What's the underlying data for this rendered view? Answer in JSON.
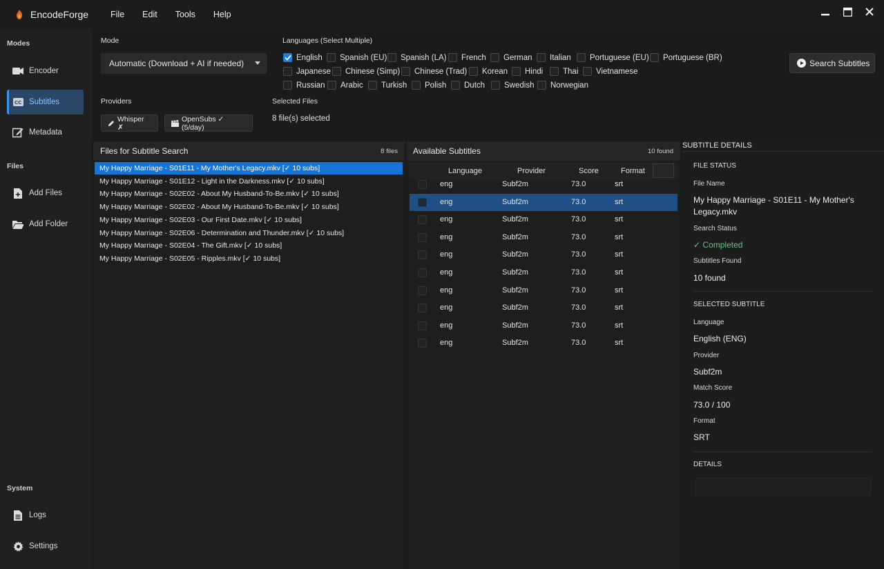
{
  "app": {
    "title": "EncodeForge"
  },
  "menu": [
    "File",
    "Edit",
    "Tools",
    "Help"
  ],
  "sidebar": {
    "sections": {
      "modes": "Modes",
      "files": "Files",
      "system": "System"
    },
    "items": {
      "encoder": "Encoder",
      "subtitles": "Subtitles",
      "metadata": "Metadata",
      "add_files": "Add Files",
      "add_folder": "Add Folder",
      "logs": "Logs",
      "settings": "Settings"
    }
  },
  "mode": {
    "label": "Mode",
    "value": "Automatic (Download + AI if needed)"
  },
  "languages": {
    "label": "Languages (Select Multiple)",
    "items": [
      {
        "name": "English",
        "checked": true
      },
      {
        "name": "Spanish (EU)",
        "checked": false
      },
      {
        "name": "Spanish (LA)",
        "checked": false
      },
      {
        "name": "French",
        "checked": false
      },
      {
        "name": "German",
        "checked": false
      },
      {
        "name": "Italian",
        "checked": false
      },
      {
        "name": "Portuguese (EU)",
        "checked": false
      },
      {
        "name": "Portuguese (BR)",
        "checked": false
      },
      {
        "name": "Japanese",
        "checked": false
      },
      {
        "name": "Chinese (Simp)",
        "checked": false
      },
      {
        "name": "Chinese (Trad)",
        "checked": false
      },
      {
        "name": "Korean",
        "checked": false
      },
      {
        "name": "Hindi",
        "checked": false
      },
      {
        "name": "Thai",
        "checked": false
      },
      {
        "name": "Vietnamese",
        "checked": false
      },
      {
        "name": "Russian",
        "checked": false
      },
      {
        "name": "Arabic",
        "checked": false
      },
      {
        "name": "Turkish",
        "checked": false
      },
      {
        "name": "Polish",
        "checked": false
      },
      {
        "name": "Dutch",
        "checked": false
      },
      {
        "name": "Swedish",
        "checked": false
      },
      {
        "name": "Norwegian",
        "checked": false
      }
    ]
  },
  "search_button": "Search Subtitles",
  "providers": {
    "label": "Providers",
    "whisper": "Whisper ✗",
    "opensubs": "OpenSubs ✓ (5/day)"
  },
  "selected_files": {
    "label": "Selected Files",
    "value": "8 file(s) selected"
  },
  "files_panel": {
    "title": "Files for Subtitle Search",
    "count": "8 files",
    "files": [
      "My Happy Marriage - S01E11 - My Mother's Legacy.mkv [✓ 10 subs]",
      "My Happy Marriage - S01E12 - Light in the Darkness.mkv [✓ 10 subs]",
      "My Happy Marriage - S02E02 - About My Husband-To-Be.mkv [✓ 10 subs]",
      "My Happy Marriage - S02E02 - About My Husband-To-Be.mkv [✓ 10 subs]",
      "My Happy Marriage - S02E03 - Our First Date.mkv [✓ 10 subs]",
      "My Happy Marriage - S02E06 - Determination and Thunder.mkv [✓ 10 subs]",
      "My Happy Marriage - S02E04 - The Gift.mkv [✓ 10 subs]",
      "My Happy Marriage - S02E05 - Ripples.mkv [✓ 10 subs]"
    ]
  },
  "subs_panel": {
    "title": "Available Subtitles",
    "count": "10 found",
    "columns": [
      "Language",
      "Provider",
      "Score",
      "Format"
    ],
    "rows": [
      [
        "eng",
        "Subf2m",
        "73.0",
        "srt"
      ],
      [
        "eng",
        "Subf2m",
        "73.0",
        "srt"
      ],
      [
        "eng",
        "Subf2m",
        "73.0",
        "srt"
      ],
      [
        "eng",
        "Subf2m",
        "73.0",
        "srt"
      ],
      [
        "eng",
        "Subf2m",
        "73.0",
        "srt"
      ],
      [
        "eng",
        "Subf2m",
        "73.0",
        "srt"
      ],
      [
        "eng",
        "Subf2m",
        "73.0",
        "srt"
      ],
      [
        "eng",
        "Subf2m",
        "73.0",
        "srt"
      ],
      [
        "eng",
        "Subf2m",
        "73.0",
        "srt"
      ],
      [
        "eng",
        "Subf2m",
        "73.0",
        "srt"
      ]
    ]
  },
  "details": {
    "title": "SUBTITLE DETAILS",
    "file_status": "FILE STATUS",
    "file_name_label": "File Name",
    "file_name": "My Happy Marriage - S01E11 - My Mother's Legacy.mkv",
    "search_status_label": "Search Status",
    "search_status": "✓ Completed",
    "found_label": "Subtitles Found",
    "found": "10 found",
    "selected_subtitle": "SELECTED SUBTITLE",
    "language_label": "Language",
    "language": "English (ENG)",
    "provider_label": "Provider",
    "provider": "Subf2m",
    "match_label": "Match Score",
    "match": "73.0 / 100",
    "format_label": "Format",
    "format": "SRT",
    "details_label": "DETAILS"
  },
  "colors": {
    "accent": "#1574d6",
    "selected_row": "#1f4f85",
    "success": "#6cc28d"
  }
}
